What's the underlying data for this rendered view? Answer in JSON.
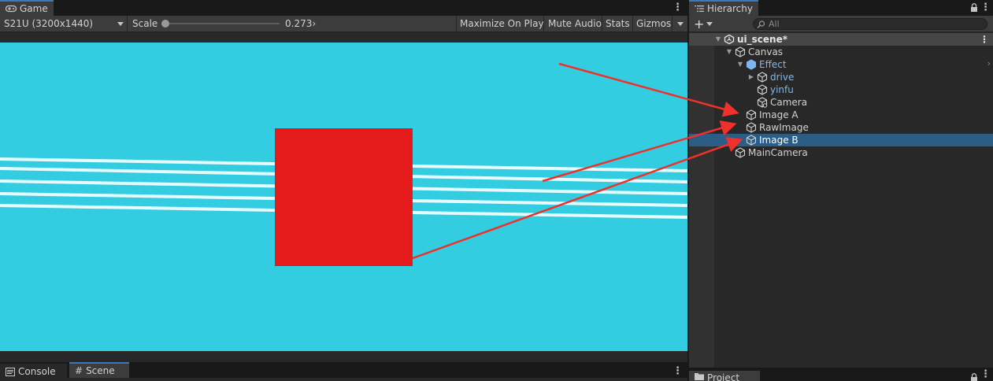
{
  "game_panel": {
    "tab_label": "Game",
    "resolution": "S21U (3200x1440)",
    "scale_label": "Scale",
    "scale_value": "0.273›",
    "scale_fraction": 0.02,
    "buttons": {
      "maximize": "Maximize On Play",
      "mute": "Mute Audio",
      "stats": "Stats",
      "gizmos": "Gizmos"
    },
    "viewport": {
      "background_color": "#33cde2",
      "square_color": "#e51b1b",
      "line_color": "#e6fbfd",
      "arrow_color": "#f0302b"
    }
  },
  "bottom_tabs": {
    "console": "Console",
    "scene": "Scene"
  },
  "hierarchy": {
    "tab_label": "Hierarchy",
    "add_label": "+",
    "search_placeholder": "All",
    "items": [
      {
        "label": "ui_scene*",
        "kind": "scene",
        "depth": 0,
        "expanded": true,
        "selected": false
      },
      {
        "label": "Canvas",
        "kind": "gameobject",
        "depth": 1,
        "expanded": true,
        "selected": false
      },
      {
        "label": "Effect",
        "kind": "prefab",
        "depth": 2,
        "expanded": true,
        "selected": false
      },
      {
        "label": "drive",
        "kind": "prefab-child",
        "depth": 3,
        "expanded": false,
        "selected": false
      },
      {
        "label": "yinfu",
        "kind": "prefab-child",
        "depth": 3,
        "expanded": null,
        "selected": false
      },
      {
        "label": "Camera",
        "kind": "camera",
        "depth": 3,
        "expanded": null,
        "selected": false
      },
      {
        "label": "Image A",
        "kind": "gameobject",
        "depth": 2,
        "expanded": null,
        "selected": false
      },
      {
        "label": "RawImage",
        "kind": "gameobject",
        "depth": 2,
        "expanded": null,
        "selected": false
      },
      {
        "label": "Image B",
        "kind": "gameobject",
        "depth": 2,
        "expanded": null,
        "selected": true
      },
      {
        "label": "MainCamera",
        "kind": "gameobject",
        "depth": 1,
        "expanded": null,
        "selected": false
      }
    ],
    "selection_color": "#2c5d87"
  },
  "project": {
    "tab_label": "Project"
  },
  "icons": {
    "game": "gamepad-icon",
    "hierarchy": "list-icon",
    "console": "console-icon",
    "scene": "grid-icon",
    "project": "folder-icon",
    "search": "search-icon",
    "lock": "lock-icon",
    "gameobject": "cube-icon",
    "prefab": "prefab-cube-icon",
    "scene_root": "unity-scene-icon"
  }
}
